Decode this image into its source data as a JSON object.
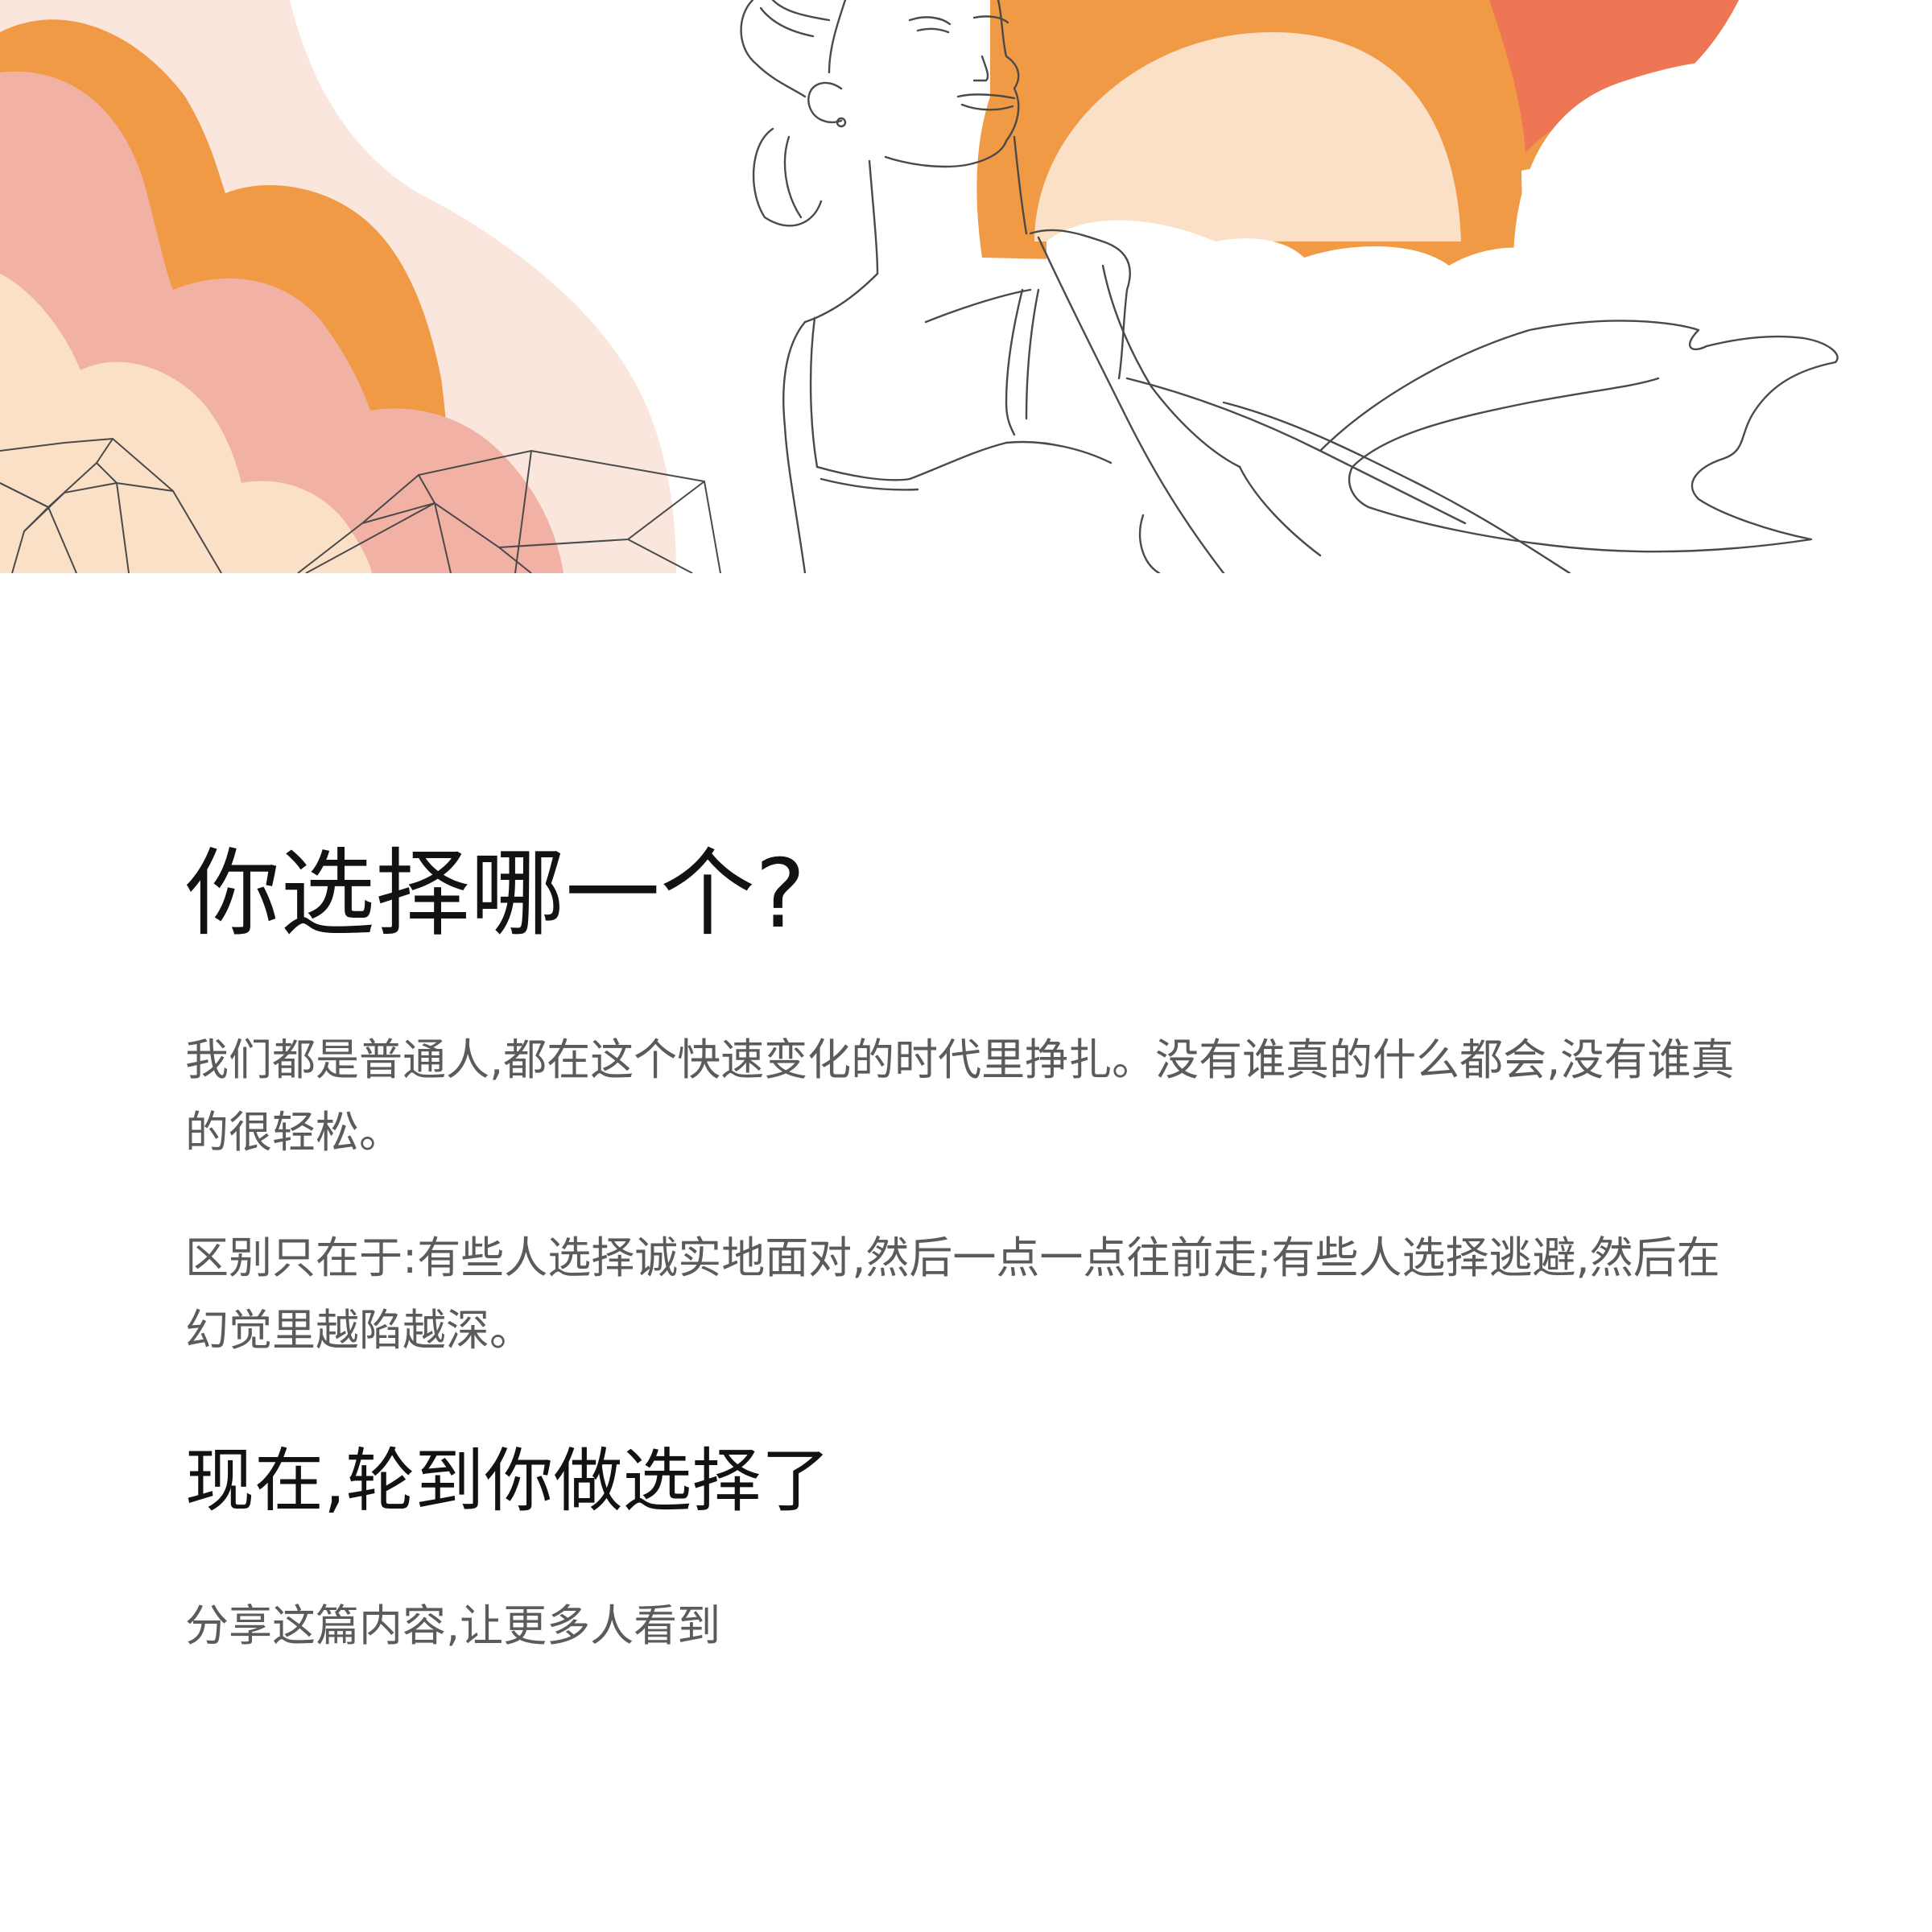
{
  "article": {
    "title": "你选择哪一个?",
    "paragraphs": [
      "我们都是普通人,都在这个快速变化的时代里挣扎。没有谁真的什么都会,没有谁真的很轻松。",
      "区别只在于:有些人选择诚实地面对,然后一点一点往前走;有些人选择逃避,然后在幻觉里越陷越深。"
    ],
    "subtitle": "现在,轮到你做选择了",
    "share_text": "分享这篇内容,让更多人看到"
  },
  "hero": {
    "colors": {
      "orange": "#F19A45",
      "peach": "#FBE0C8",
      "pink": "#F2B1A5",
      "light_pink": "#FBE6DD",
      "coral": "#EE7655",
      "line": "#4a4a4a"
    }
  }
}
